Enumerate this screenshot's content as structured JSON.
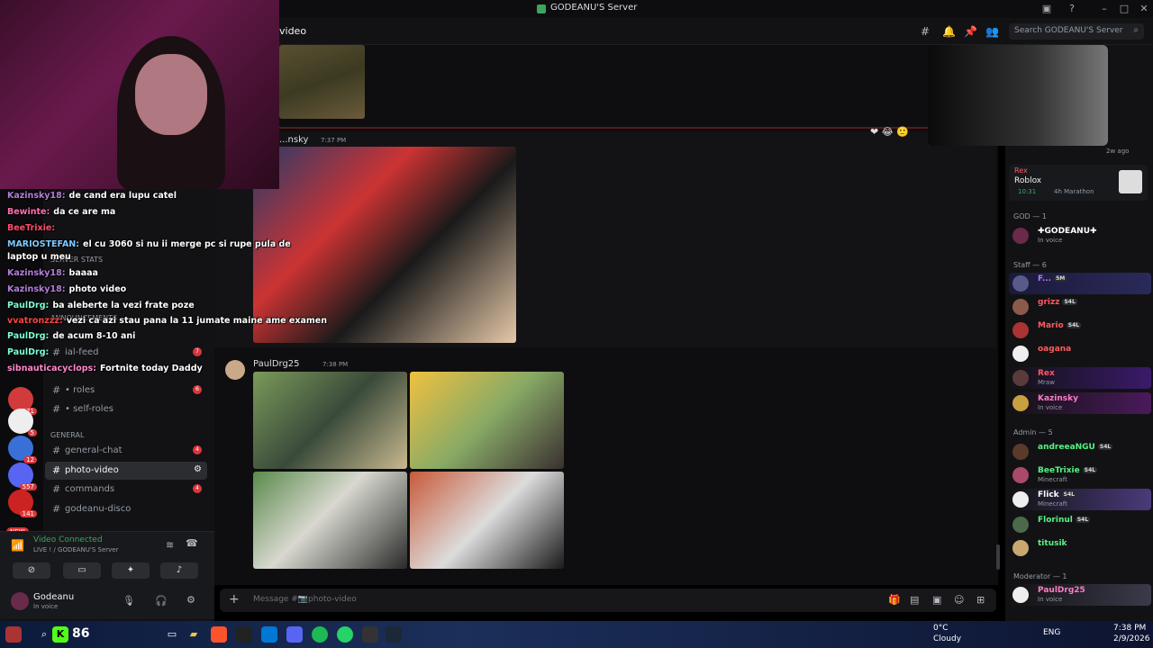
{
  "window": {
    "title": "GODEANU'S Server",
    "search_placeholder": "Search GODEANU'S Server",
    "channel_title": "video"
  },
  "stream_chat": [
    {
      "name": "Kazinsky18:",
      "color": "#b57edc",
      "text": "de cand era lupu catel"
    },
    {
      "name": "Bewinte:",
      "color": "#ff6fae",
      "text": "da ce are ma"
    },
    {
      "name": "BeeTrixie:",
      "color": "#ff4d6d",
      "text": ""
    },
    {
      "name": "MARIOSTEFAN:",
      "color": "#7fc9ff",
      "text": "el cu 3060 si nu ii merge pc si rupe pula de"
    },
    {
      "name": "",
      "color": "#ffffff",
      "text": "laptop u meu"
    },
    {
      "name": "Kazinsky18:",
      "color": "#b57edc",
      "text": "baaaa"
    },
    {
      "name": "Kazinsky18:",
      "color": "#b57edc",
      "text": "photo video"
    },
    {
      "name": "PaulDrg:",
      "color": "#7fffd4",
      "text": "ba aleberte la vezi frate poze"
    },
    {
      "name": "vvatronzzz:",
      "color": "#ff4444",
      "text": "vezi ca azi stau pana la 11 jumate maine ame examen"
    },
    {
      "name": "PaulDrg:",
      "color": "#7fffd4",
      "text": "de acum 8-10 ani"
    },
    {
      "name": "PaulDrg:",
      "color": "#7fffd4",
      "text": ""
    },
    {
      "name": "sibnauticacyclops:",
      "color": "#ff88cc",
      "text": "Fortnite today Daddy"
    }
  ],
  "sidebar": {
    "categories": {
      "general": "GENERAL",
      "server_stats": "SERVER STATS",
      "announcements": "ANNOUNCEMENTS"
    },
    "channels": [
      {
        "name": "• roles",
        "badge": "6"
      },
      {
        "name": "• self-roles",
        "badge": ""
      },
      {
        "name": "general-chat",
        "badge": "4"
      },
      {
        "name": "photo-video",
        "badge": ""
      },
      {
        "name": "commands",
        "badge": "4"
      },
      {
        "name": "godeanu-disco",
        "badge": ""
      },
      {
        "name": "ial-feed",
        "badge": "7"
      }
    ],
    "guild_badges": [
      "271",
      "5",
      "12",
      "557",
      "141"
    ],
    "new_label": "NEW",
    "voice": {
      "status": "Video Connected",
      "sub": "LIVE ! / GODEANU'S Server"
    },
    "user": {
      "name": "Godeanu",
      "status": "In voice"
    }
  },
  "messages": [
    {
      "author": "...nsky",
      "color": "#ff5a5f",
      "time": "7:37 PM"
    },
    {
      "author": "PaulDrg25",
      "color": "#ff7cc4",
      "time": "7:38 PM"
    }
  ],
  "composer": {
    "placeholder": "Message #📷photo-video"
  },
  "activity": {
    "ago": "2w ago",
    "name": "Rex",
    "game": "Roblox",
    "time": "10:31",
    "detail": "4h Marathon"
  },
  "members": {
    "groups": [
      {
        "label": "GOD — 1"
      },
      {
        "label": "Staff — 6"
      },
      {
        "label": "Admin — 5"
      },
      {
        "label": "Moderator — 1"
      }
    ],
    "list": [
      {
        "name": "✚GODEANU✚",
        "color": "#ffffff",
        "status": "In voice",
        "tag": ""
      },
      {
        "name": "F...",
        "color": "#b47cff",
        "status": "",
        "tag": "5M"
      },
      {
        "name": "grizz",
        "color": "#ff5a5f",
        "status": "",
        "tag": "S4L"
      },
      {
        "name": "Mario",
        "color": "#ff5a5f",
        "status": "",
        "tag": "S4L"
      },
      {
        "name": "oagana",
        "color": "#ff5a5f",
        "status": "",
        "tag": ""
      },
      {
        "name": "Rex",
        "color": "#ff5a5f",
        "status": "Mraw",
        "tag": ""
      },
      {
        "name": "Kazinsky",
        "color": "#ff7cc4",
        "status": "In voice",
        "tag": ""
      },
      {
        "name": "andreeaNGU",
        "color": "#57f287",
        "status": "",
        "tag": "S4L"
      },
      {
        "name": "BeeTrixie",
        "color": "#57f287",
        "status": "Minecraft",
        "tag": "S4L"
      },
      {
        "name": "Flick",
        "color": "#ffffff",
        "status": "Minecraft",
        "tag": "S4L"
      },
      {
        "name": "Florinul",
        "color": "#57f287",
        "status": "",
        "tag": "S4L"
      },
      {
        "name": "titusik",
        "color": "#57f287",
        "status": "",
        "tag": ""
      },
      {
        "name": "PaulDrg25",
        "color": "#ff7cc4",
        "status": "In voice",
        "tag": ""
      }
    ]
  },
  "taskbar": {
    "counter": "86",
    "temp": "0°C",
    "weather": "Cloudy",
    "lang": "ENG",
    "time": "7:38 PM",
    "date": "2/9/2026"
  }
}
